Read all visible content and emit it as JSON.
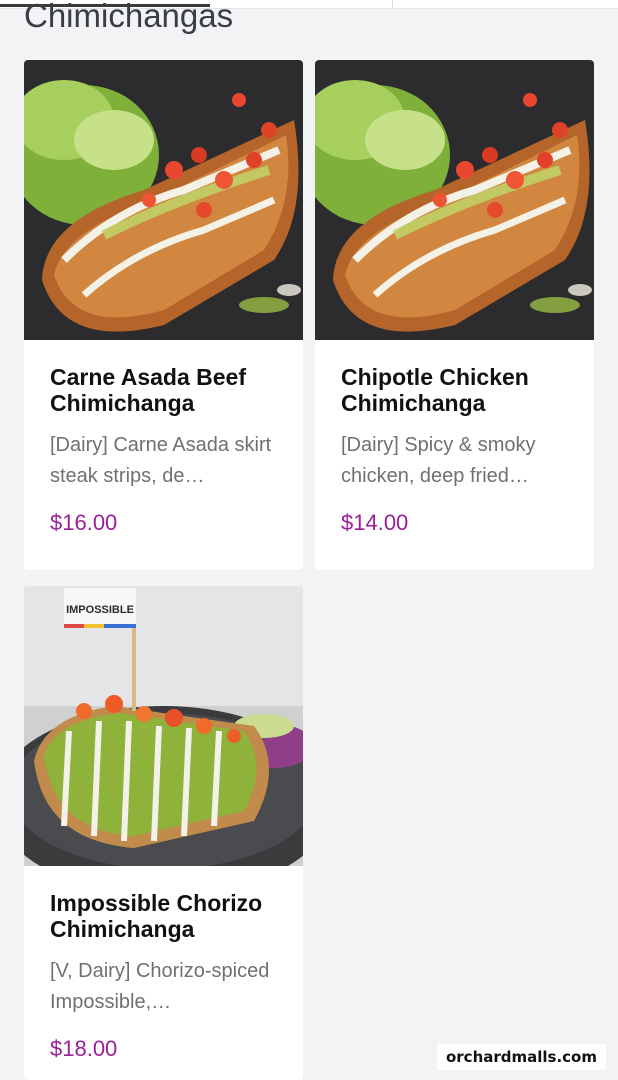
{
  "section": {
    "title": "Chimichangas"
  },
  "items": [
    {
      "name": "Carne Asada Beef Chimichanga",
      "description": "[Dairy] Carne Asada skirt steak strips, de…",
      "price": "$16.00"
    },
    {
      "name": "Chipotle Chicken Chimichanga",
      "description": "[Dairy] Spicy & smoky chicken, deep fried…",
      "price": "$14.00"
    },
    {
      "name": "Impossible Chorizo Chimichanga",
      "description": "[V, Dairy] Chorizo-spiced Impossible,…",
      "price": "$18.00",
      "flag_text": "IMPOSSIBLE"
    }
  ],
  "watermark": "orchardmalls.com",
  "colors": {
    "price": "#9a1f98",
    "background": "#f2f3f5"
  }
}
